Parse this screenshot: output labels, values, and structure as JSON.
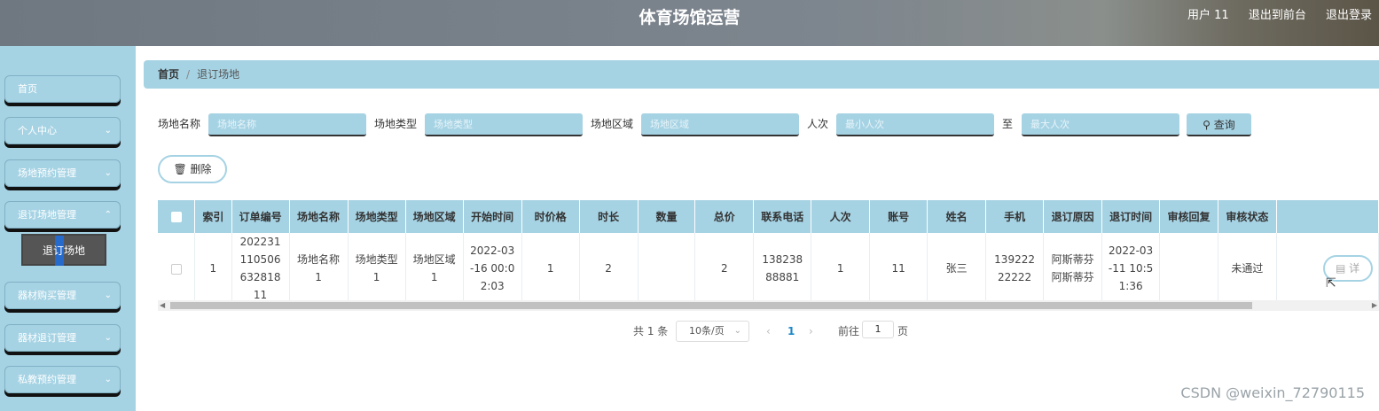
{
  "header": {
    "title": "体育场馆运营",
    "user": "用户 11",
    "back_to_front": "退出到前台",
    "logout": "退出登录"
  },
  "sidebar": {
    "items": [
      {
        "label": "首页",
        "has_children": false
      },
      {
        "label": "个人中心",
        "has_children": true
      },
      {
        "label": "场地预约管理",
        "has_children": true
      },
      {
        "label": "退订场地管理",
        "has_children": true
      },
      {
        "label": "器材购买管理",
        "has_children": true
      },
      {
        "label": "器材退订管理",
        "has_children": true
      },
      {
        "label": "私教预约管理",
        "has_children": true
      }
    ],
    "active_sub": "退订场地"
  },
  "breadcrumb": {
    "home": "首页",
    "current": "退订场地"
  },
  "search": {
    "venue_name_label": "场地名称",
    "venue_name_placeholder": "场地名称",
    "venue_type_label": "场地类型",
    "venue_type_placeholder": "场地类型",
    "venue_area_label": "场地区域",
    "venue_area_placeholder": "场地区域",
    "people_label": "人次",
    "people_min_placeholder": "最小人次",
    "to_label": "至",
    "people_max_placeholder": "最大人次",
    "query_button": "查询"
  },
  "actions": {
    "delete_button": "删除"
  },
  "table": {
    "headers": [
      "索引",
      "订单编号",
      "场地名称",
      "场地类型",
      "场地区域",
      "开始时间",
      "时价格",
      "时长",
      "数量",
      "总价",
      "联系电话",
      "人次",
      "账号",
      "姓名",
      "手机",
      "退订原因",
      "退订时间",
      "审核回复",
      "审核状态"
    ],
    "rows": [
      [
        "1",
        "20223111050663281811",
        "场地名称1",
        "场地类型1",
        "场地区域1",
        "2022-03-16 00:02:03",
        "1",
        "2",
        "",
        "2",
        "13823888881",
        "1",
        "11",
        "张三",
        "13922222222",
        "阿斯蒂芬阿斯蒂芬",
        "2022-03-11 10:51:36",
        "",
        "未通过"
      ]
    ],
    "detail_button": "详"
  },
  "pagination": {
    "total": "共 1 条",
    "page_size": "10条/页",
    "current_page": "1",
    "goto_label": "前往",
    "goto_value": "1",
    "page_unit": "页"
  },
  "watermark": "CSDN @weixin_72790115"
}
